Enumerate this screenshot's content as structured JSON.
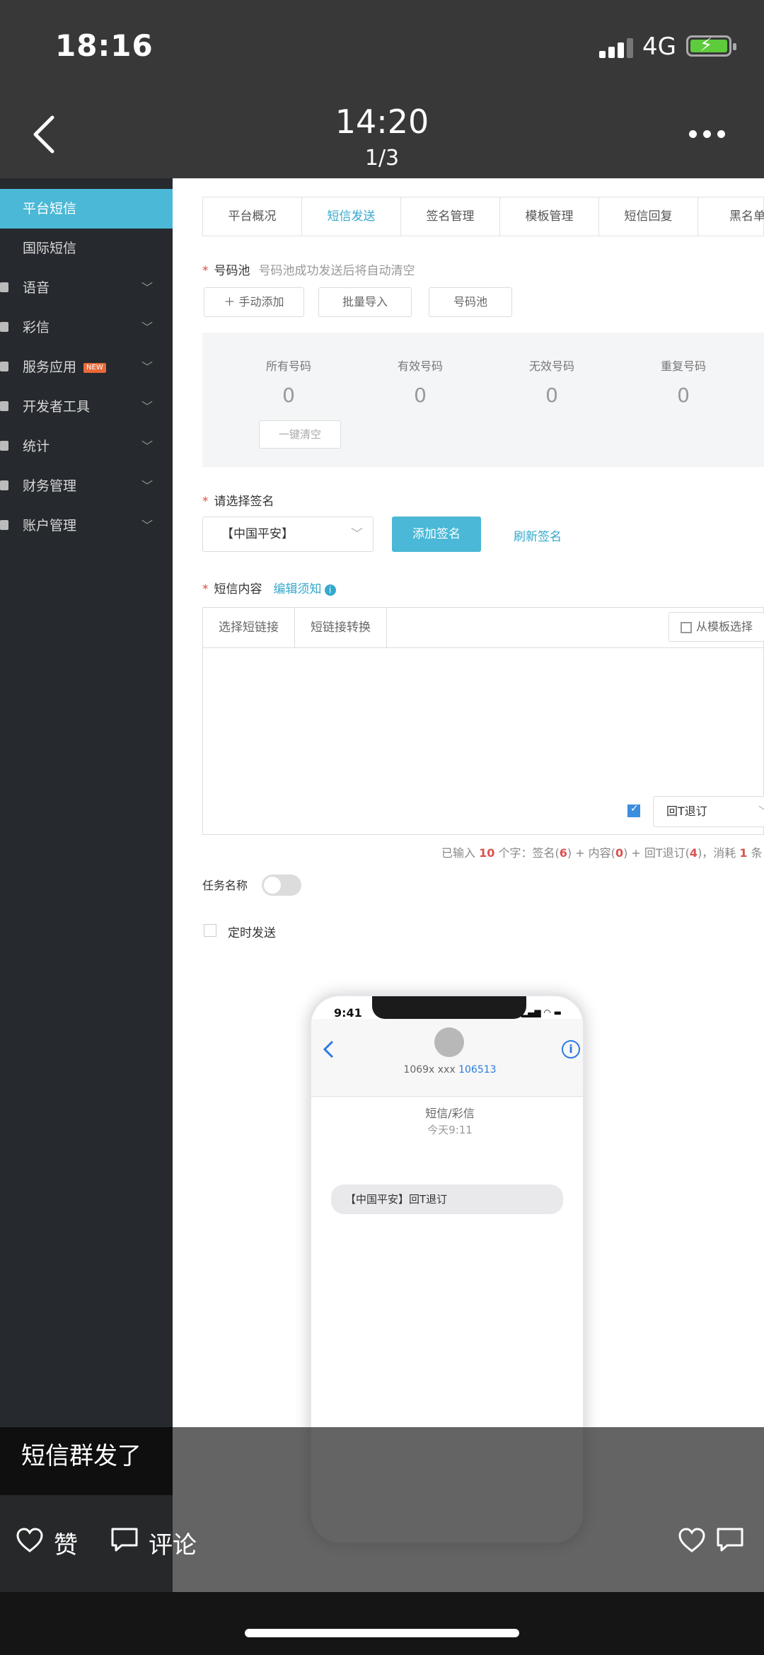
{
  "status_bar": {
    "time": "18:16",
    "network": "4G"
  },
  "viewer": {
    "time": "14:20",
    "index": "1/3"
  },
  "sidebar": {
    "items": [
      {
        "label": "平台短信",
        "active": true
      },
      {
        "label": "国际短信"
      },
      {
        "label": "语音"
      },
      {
        "label": "彩信"
      },
      {
        "label": "服务应用",
        "badge": "NEW"
      },
      {
        "label": "开发者工具"
      },
      {
        "label": "统计"
      },
      {
        "label": "财务管理"
      },
      {
        "label": "账户管理"
      }
    ]
  },
  "tabs": [
    "平台概况",
    "短信发送",
    "签名管理",
    "模板管理",
    "短信回复",
    "黑名单"
  ],
  "number_pool": {
    "label": "号码池",
    "hint": "号码池成功发送后将自动清空",
    "buttons": [
      "＋ 手动添加",
      "批量导入",
      "号码池"
    ],
    "stats": [
      {
        "label": "所有号码",
        "value": "0"
      },
      {
        "label": "有效号码",
        "value": "0"
      },
      {
        "label": "无效号码",
        "value": "0"
      },
      {
        "label": "重复号码",
        "value": "0"
      }
    ],
    "clear_button": "一键清空"
  },
  "signature": {
    "label": "请选择签名",
    "selected": "【中国平安】",
    "add_button": "添加签名",
    "refresh_link": "刷新签名"
  },
  "content": {
    "label": "短信内容",
    "guide_link": "编辑须知",
    "tools": [
      "选择短链接",
      "短链接转换"
    ],
    "template_button": "从模板选择",
    "unsubscribe_select": "回T退订",
    "counter": {
      "p1": "已输入",
      "count": "10",
      "p2": "个字：签名(",
      "sig": "6",
      "p3": ") + 内容(",
      "body": "0",
      "p4": ") + 回T退订(",
      "unsub": "4",
      "p5": ")，消耗",
      "cost": "1",
      "p6": "条"
    }
  },
  "task_name_label": "任务名称",
  "scheduled_label": "定时发送",
  "phone_preview": {
    "time": "9:41",
    "sender": "1069x xxx",
    "sender_highlight": "106513",
    "type": "短信/彩信",
    "when": "今天9:11",
    "bubble": "【中国平安】回T退订"
  },
  "post": {
    "caption": "短信群发了",
    "like_label": "赞",
    "comment_label": "评论"
  },
  "colors": {
    "accent": "#4ab8d6",
    "sidebar_bg": "#26292d",
    "danger": "#e04a3c"
  }
}
